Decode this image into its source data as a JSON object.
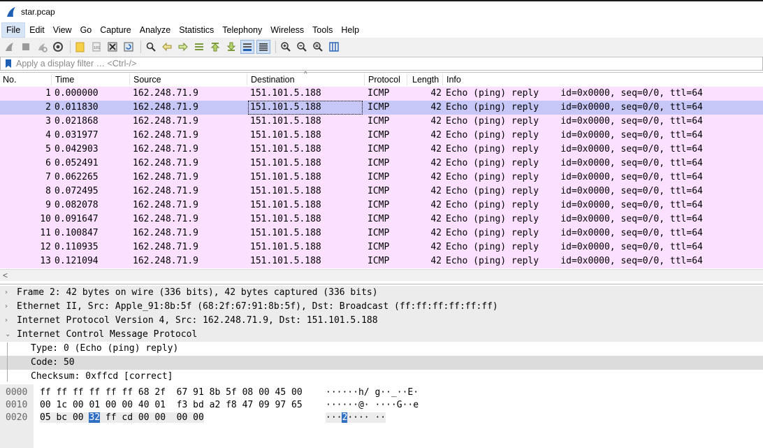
{
  "window": {
    "title": "star.pcap"
  },
  "menu": [
    "File",
    "Edit",
    "View",
    "Go",
    "Capture",
    "Analyze",
    "Statistics",
    "Telephony",
    "Wireless",
    "Tools",
    "Help"
  ],
  "filter": {
    "placeholder": "Apply a display filter … <Ctrl-/>"
  },
  "columns": [
    "No.",
    "Time",
    "Source",
    "Destination",
    "Protocol",
    "Length",
    "Info"
  ],
  "packets": [
    {
      "no": "1",
      "time": "0.000000",
      "src": "162.248.71.9",
      "dst": "151.101.5.188",
      "proto": "ICMP",
      "len": "42",
      "info": "Echo (ping) reply    id=0x0000, seq=0/0, ttl=64"
    },
    {
      "no": "2",
      "time": "0.011830",
      "src": "162.248.71.9",
      "dst": "151.101.5.188",
      "proto": "ICMP",
      "len": "42",
      "info": "Echo (ping) reply    id=0x0000, seq=0/0, ttl=64"
    },
    {
      "no": "3",
      "time": "0.021868",
      "src": "162.248.71.9",
      "dst": "151.101.5.188",
      "proto": "ICMP",
      "len": "42",
      "info": "Echo (ping) reply    id=0x0000, seq=0/0, ttl=64"
    },
    {
      "no": "4",
      "time": "0.031977",
      "src": "162.248.71.9",
      "dst": "151.101.5.188",
      "proto": "ICMP",
      "len": "42",
      "info": "Echo (ping) reply    id=0x0000, seq=0/0, ttl=64"
    },
    {
      "no": "5",
      "time": "0.042903",
      "src": "162.248.71.9",
      "dst": "151.101.5.188",
      "proto": "ICMP",
      "len": "42",
      "info": "Echo (ping) reply    id=0x0000, seq=0/0, ttl=64"
    },
    {
      "no": "6",
      "time": "0.052491",
      "src": "162.248.71.9",
      "dst": "151.101.5.188",
      "proto": "ICMP",
      "len": "42",
      "info": "Echo (ping) reply    id=0x0000, seq=0/0, ttl=64"
    },
    {
      "no": "7",
      "time": "0.062265",
      "src": "162.248.71.9",
      "dst": "151.101.5.188",
      "proto": "ICMP",
      "len": "42",
      "info": "Echo (ping) reply    id=0x0000, seq=0/0, ttl=64"
    },
    {
      "no": "8",
      "time": "0.072495",
      "src": "162.248.71.9",
      "dst": "151.101.5.188",
      "proto": "ICMP",
      "len": "42",
      "info": "Echo (ping) reply    id=0x0000, seq=0/0, ttl=64"
    },
    {
      "no": "9",
      "time": "0.082078",
      "src": "162.248.71.9",
      "dst": "151.101.5.188",
      "proto": "ICMP",
      "len": "42",
      "info": "Echo (ping) reply    id=0x0000, seq=0/0, ttl=64"
    },
    {
      "no": "10",
      "time": "0.091647",
      "src": "162.248.71.9",
      "dst": "151.101.5.188",
      "proto": "ICMP",
      "len": "42",
      "info": "Echo (ping) reply    id=0x0000, seq=0/0, ttl=64"
    },
    {
      "no": "11",
      "time": "0.100847",
      "src": "162.248.71.9",
      "dst": "151.101.5.188",
      "proto": "ICMP",
      "len": "42",
      "info": "Echo (ping) reply    id=0x0000, seq=0/0, ttl=64"
    },
    {
      "no": "12",
      "time": "0.110935",
      "src": "162.248.71.9",
      "dst": "151.101.5.188",
      "proto": "ICMP",
      "len": "42",
      "info": "Echo (ping) reply    id=0x0000, seq=0/0, ttl=64"
    },
    {
      "no": "13",
      "time": "0.121094",
      "src": "162.248.71.9",
      "dst": "151.101.5.188",
      "proto": "ICMP",
      "len": "42",
      "info": "Echo (ping) reply    id=0x0000, seq=0/0, ttl=64"
    }
  ],
  "details": [
    {
      "text": "Frame 2: 42 bytes on wire (336 bits), 42 bytes captured (336 bits)",
      "expander": "›"
    },
    {
      "text": "Ethernet II, Src: Apple_91:8b:5f (68:2f:67:91:8b:5f), Dst: Broadcast (ff:ff:ff:ff:ff:ff)",
      "expander": "›"
    },
    {
      "text": "Internet Protocol Version 4, Src: 162.248.71.9, Dst: 151.101.5.188",
      "expander": "›"
    },
    {
      "text": "Internet Control Message Protocol",
      "expander": "⌄"
    },
    {
      "text": "Type: 0 (Echo (ping) reply)"
    },
    {
      "text": "Code: 50"
    },
    {
      "text": "Checksum: 0xffcd [correct]"
    }
  ],
  "bytes": {
    "offsets": [
      "0000",
      "0010",
      "0020"
    ],
    "row0_hex": "ff ff ff ff ff ff 68 2f  67 91 8b 5f 08 00 45 00",
    "row0_ascii": "······h/ g··_··E·",
    "row1_hex": "00 1c 00 01 00 00 40 01  f3 bd a2 f8 47 09 97 65",
    "row1_ascii": "······@· ····G··e",
    "row2_hex_pre": "05 bc 00 ",
    "row2_hex_sel": "32",
    "row2_hex_post": " ff cd 00 00  00 00",
    "row2_ascii_pre": "···",
    "row2_ascii_sel": "2",
    "row2_ascii_post": "···· ··"
  },
  "colors": {
    "row_bg": "#fce0ff",
    "row_selected": "#c6c6f7",
    "byte_highlight": "#2f6fc4"
  }
}
